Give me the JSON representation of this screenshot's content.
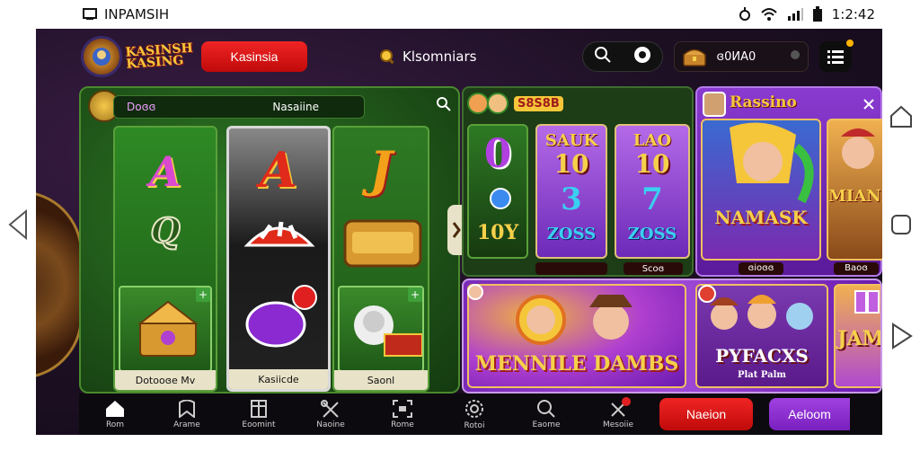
{
  "status_bar": {
    "app_name": "INPAMSIH",
    "time": "1:2:42"
  },
  "header": {
    "logo_text": "KASINSH KASING",
    "primary_button": "Kasinsia",
    "search_label": "Klsomniars",
    "coins_value": "ɞ0ИA0"
  },
  "left_panel": {
    "badge_text": "Doɞɞ",
    "bar_label": "Nasaiine",
    "reels": [
      {
        "top_symbol": "A",
        "mid_symbol": "Q",
        "caption": "Dotooɞe Мv"
      },
      {
        "top_symbol": "A",
        "mid_symbol": "",
        "caption": "Kasiicde"
      },
      {
        "top_symbol": "J",
        "mid_symbol": "",
        "caption": "Saonl"
      }
    ]
  },
  "slot_panel": {
    "header_text": "S8S8B",
    "cards": [
      {
        "top": "0",
        "mid": "",
        "bottom": "10Y",
        "caption": ""
      },
      {
        "top": "SAUK",
        "mid": "10",
        "bottom": "ZOSS",
        "caption": ""
      },
      {
        "top": "LAO",
        "mid": "10",
        "bottom": "ZOSS",
        "caption": "Scoɞ"
      }
    ]
  },
  "rassino_panel": {
    "title": "Rassino",
    "card_title": "NAMASK",
    "card_caption": "ɞioɞɞ",
    "side_title": "MIANN",
    "side_caption": "Baoɞ"
  },
  "promo_panel": {
    "left_title": "MENNILE DAMBS",
    "right_title": "PYFACXS",
    "right_sub": "Plat Palm",
    "side_title": "JAM"
  },
  "bottom_nav": {
    "items": [
      {
        "label": "Rom",
        "icon": "home-icon"
      },
      {
        "label": "Arame",
        "icon": "bookmark-icon"
      },
      {
        "label": "Eoomint",
        "icon": "grid-icon"
      },
      {
        "label": "Naoine",
        "icon": "tools-icon"
      },
      {
        "label": "Rome",
        "icon": "scan-icon"
      },
      {
        "label": "Rotoi",
        "icon": "settings-icon"
      },
      {
        "label": "Eaome",
        "icon": "search-icon"
      },
      {
        "label": "Mesoiie",
        "icon": "location-icon"
      }
    ],
    "red_button": "Naeion",
    "purple_button": "Aeloom"
  },
  "colors": {
    "accent_red": "#e01414",
    "accent_purple": "#8a30d0",
    "felt_green": "#2f7a26",
    "gold": "#f5c63a"
  }
}
